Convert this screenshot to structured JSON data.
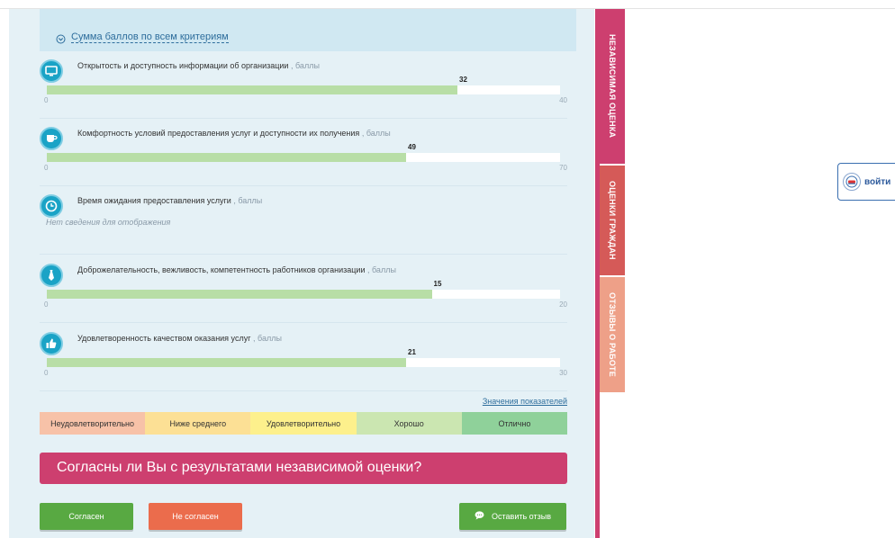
{
  "sum": {
    "link_label": "Сумма баллов по всем критериям"
  },
  "criteria": [
    {
      "title": "Открытость и доступность информации об организации",
      "unit": ", баллы",
      "value": "32",
      "min": "0",
      "max": "40",
      "fraction": 0.8,
      "icon": "monitor-icon"
    },
    {
      "title": "Комфортность условий предоставления услуг и доступности их получения",
      "unit": ", баллы",
      "value": "49",
      "min": "0",
      "max": "70",
      "fraction": 0.7,
      "icon": "cup-icon"
    },
    {
      "title": "Время ожидания предоставления услуги",
      "unit": ", баллы",
      "nodata": "Нет сведения для отображения",
      "icon": "clock-icon"
    },
    {
      "title": "Доброжелательность, вежливость, компетентность работников организации",
      "unit": ", баллы",
      "value": "15",
      "min": "0",
      "max": "20",
      "fraction": 0.75,
      "icon": "tie-icon"
    },
    {
      "title": "Удовлетворенность качеством оказания услуг",
      "unit": ", баллы",
      "value": "21",
      "min": "0",
      "max": "30",
      "fraction": 0.7,
      "icon": "thumbs-up-icon"
    }
  ],
  "legend": {
    "link_label": "Значения показателей",
    "levels": [
      {
        "label": "Неудовлетворительно",
        "color": "#f7c2a8"
      },
      {
        "label": "Ниже среднего",
        "color": "#fce095"
      },
      {
        "label": "Удовлетворительно",
        "color": "#fdf08c"
      },
      {
        "label": "Хорошо",
        "color": "#cbe6b1"
      },
      {
        "label": "Отлично",
        "color": "#8fd19a"
      }
    ]
  },
  "question": "Согласны ли Вы с результатами независимой оценки?",
  "buttons": {
    "agree": "Согласен",
    "disagree": "Не согласен",
    "review": "Оставить отзыв"
  },
  "tabs": [
    "НЕЗАВИСИМАЯ ОЦЕНКА",
    "ОЦЕНКИ ГРАЖДАН",
    "ОТЗЫВЫ О РАБОТЕ"
  ],
  "login": {
    "label": "войти",
    "icon": "gosuslugi-icon"
  }
}
